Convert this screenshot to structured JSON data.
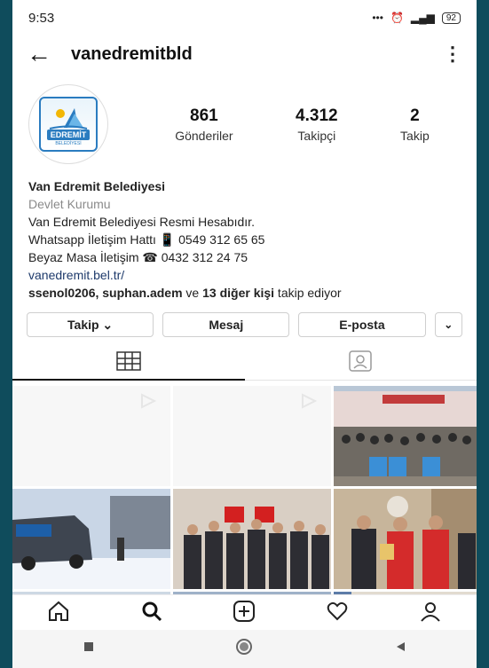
{
  "status": {
    "time": "9:53",
    "battery": "92"
  },
  "header": {
    "username": "vanedremitbld"
  },
  "avatar": {
    "logo_text": "EDREMİT",
    "logo_sub": "BELEDİYESİ"
  },
  "stats": [
    {
      "value": "861",
      "label": "Gönderiler"
    },
    {
      "value": "4.312",
      "label": "Takipçi"
    },
    {
      "value": "2",
      "label": "Takip"
    }
  ],
  "bio": {
    "name": "Van Edremit Belediyesi",
    "category": "Devlet Kurumu",
    "line1": "Van Edremit Belediyesi Resmi Hesabıdır.",
    "line2": "Whatsapp İletişim Hattı 📱 0549 312 65 65",
    "line3": "Beyaz Masa İletişim ☎ 0432 312 24 75",
    "link": "vanedremit.bel.tr/",
    "followed_users": "ssenol0206, suphan.adem",
    "followed_mid": " ve ",
    "followed_count": "13 diğer kişi",
    "followed_tail": " takip ediyor"
  },
  "buttons": {
    "follow": "Takip ⌄",
    "message": "Mesaj",
    "email": "E-posta",
    "more": "⌄"
  },
  "colors": {
    "background_frame": "#0f4c5c",
    "link": "#1e3a6b",
    "category": "#8a8a8a"
  },
  "icons": {
    "back": "arrow-left",
    "more": "vertical-dots",
    "grid_tab": "grid",
    "tagged_tab": "person-tag",
    "home": "home",
    "search": "search",
    "add": "plus-square",
    "activity": "heart",
    "profile": "person"
  }
}
